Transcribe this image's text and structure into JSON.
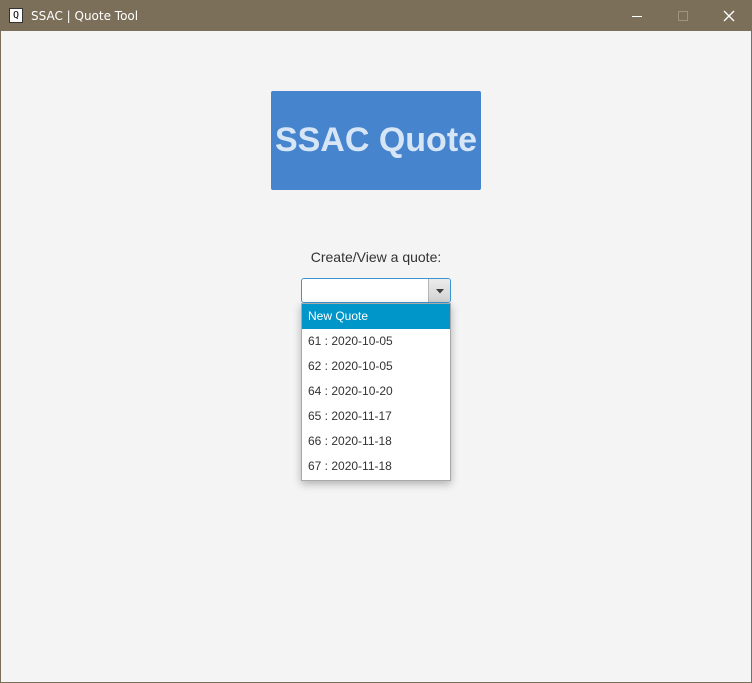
{
  "window": {
    "title": "SSAC | Quote Tool",
    "icon_glyph": "Q",
    "controls": [
      "minimize-icon",
      "maximize-icon",
      "close-icon"
    ]
  },
  "logo": {
    "text": "SSAC Quote"
  },
  "quote_selector": {
    "label": "Create/View a quote:",
    "value": "",
    "options": [
      {
        "label": "New Quote",
        "selected": true
      },
      {
        "label": "61 : 2020-10-05",
        "selected": false
      },
      {
        "label": "62 : 2020-10-05",
        "selected": false
      },
      {
        "label": "64 : 2020-10-20",
        "selected": false
      },
      {
        "label": "65 : 2020-11-17",
        "selected": false
      },
      {
        "label": "66 : 2020-11-18",
        "selected": false
      },
      {
        "label": "67 : 2020-11-18",
        "selected": false
      }
    ]
  },
  "colors": {
    "titlebar": "#7b6f59",
    "logo_background": "#4684cd",
    "logo_text": "#d7e6f7",
    "selection": "#0096c9",
    "focus_border": "#3d95d0"
  }
}
